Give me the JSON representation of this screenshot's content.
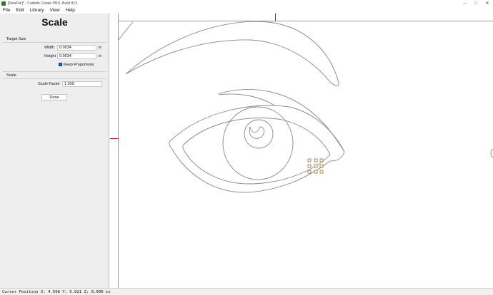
{
  "window": {
    "title": "[NewFile]* - Carbide Create PRO, Build 813"
  },
  "menu": [
    {
      "label": "File"
    },
    {
      "label": "Edit"
    },
    {
      "label": "Library"
    },
    {
      "label": "View"
    },
    {
      "label": "Help"
    }
  ],
  "panel": {
    "title": "Scale",
    "target_size_label": "Target Size",
    "width_label": "Width",
    "width_value": "0.0034",
    "width_unit": "in",
    "height_label": "Height",
    "height_value": "0.0034",
    "height_unit": "in",
    "keep_proportions_label": "Keep Proportions",
    "keep_proportions_checked": true,
    "scale_section_label": "Scale",
    "scale_factor_label": "Scale Factor",
    "scale_factor_value": "1.000",
    "done_label": "Done"
  },
  "status": {
    "cursor_position": "Cursor Position X: 4.598 Y: 5.921 Z: 0.000 in"
  },
  "colors": {
    "accent": "#1e5fbd",
    "marker": "#dd1111",
    "handle": "#8a5a00",
    "stroke": "#888888"
  }
}
